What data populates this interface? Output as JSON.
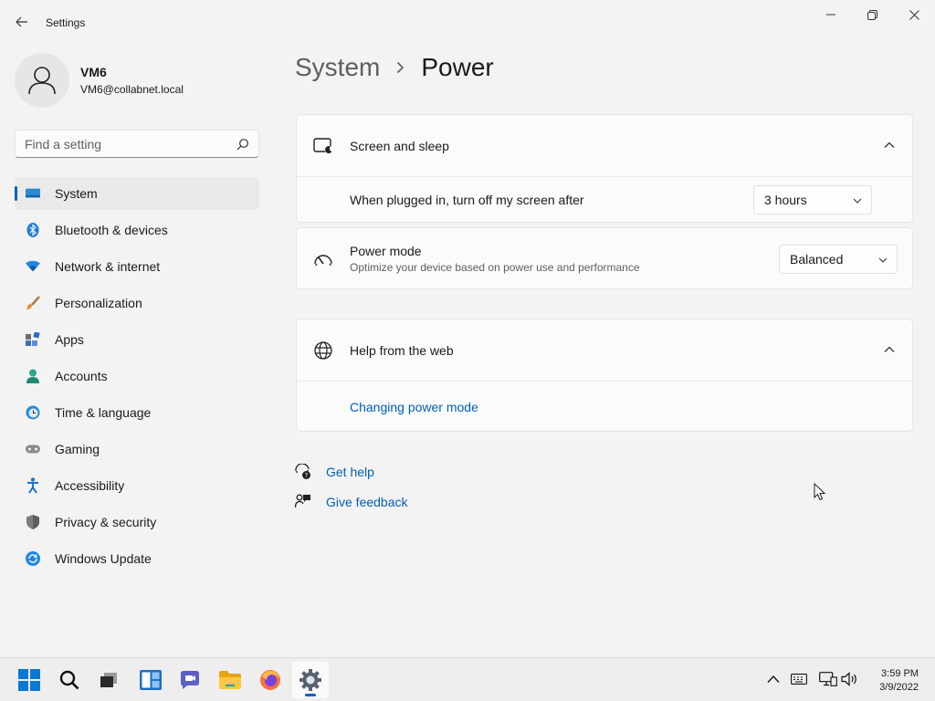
{
  "window": {
    "app_title": "Settings"
  },
  "profile": {
    "name": "VM6",
    "email": "VM6@collabnet.local"
  },
  "search": {
    "placeholder": "Find a setting"
  },
  "sidebar": {
    "items": [
      {
        "label": "System",
        "icon": "system-icon",
        "active": true
      },
      {
        "label": "Bluetooth & devices",
        "icon": "bluetooth-icon"
      },
      {
        "label": "Network & internet",
        "icon": "wifi-icon"
      },
      {
        "label": "Personalization",
        "icon": "brush-icon"
      },
      {
        "label": "Apps",
        "icon": "apps-icon"
      },
      {
        "label": "Accounts",
        "icon": "accounts-icon"
      },
      {
        "label": "Time & language",
        "icon": "clock-globe-icon"
      },
      {
        "label": "Gaming",
        "icon": "gamepad-icon"
      },
      {
        "label": "Accessibility",
        "icon": "accessibility-icon"
      },
      {
        "label": "Privacy & security",
        "icon": "shield-icon"
      },
      {
        "label": "Windows Update",
        "icon": "update-icon"
      }
    ]
  },
  "breadcrumb": {
    "parent": "System",
    "current": "Power"
  },
  "screen_sleep": {
    "title": "Screen and sleep",
    "setting_label": "When plugged in, turn off my screen after",
    "setting_value": "3 hours"
  },
  "power_mode": {
    "title": "Power mode",
    "description": "Optimize your device based on power use and performance",
    "value": "Balanced"
  },
  "help_web": {
    "title": "Help from the web",
    "link": "Changing power mode"
  },
  "bottom_links": {
    "get_help": "Get help",
    "give_feedback": "Give feedback"
  },
  "taskbar": {
    "time": "3:59 PM",
    "date": "3/9/2022"
  },
  "colors": {
    "accent": "#005fb8",
    "background": "#f3f3f3",
    "card": "#fbfbfb"
  }
}
